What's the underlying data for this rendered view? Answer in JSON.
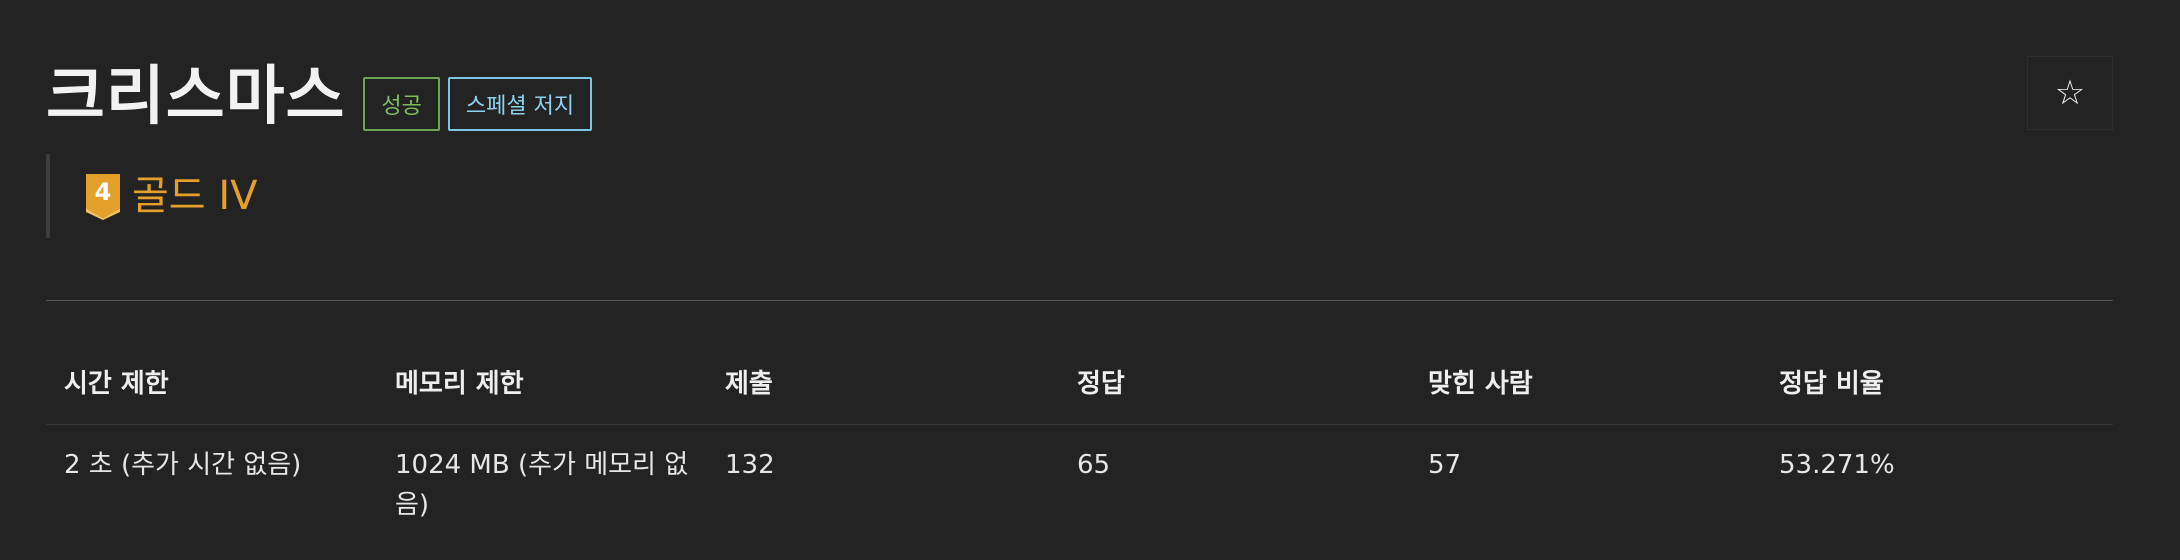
{
  "problem": {
    "title": "크리스마스",
    "badges": {
      "success": "성공",
      "special_judge": "스페셜 저지"
    },
    "tier": {
      "label": "골드 IV",
      "level_number": "4",
      "color": "#e4a02a"
    }
  },
  "actions": {
    "favorite_icon": "star-icon"
  },
  "stats": {
    "headers": [
      "시간 제한",
      "메모리 제한",
      "제출",
      "정답",
      "맞힌 사람",
      "정답 비율"
    ],
    "values": [
      "2 초 (추가 시간 없음)",
      "1024 MB (추가 메모리 없음)",
      "132",
      "65",
      "57",
      "53.271%"
    ]
  },
  "colors": {
    "background": "#232323",
    "success": "#7fbf5f",
    "special_judge": "#8fd3f0",
    "gold": "#e4a02a"
  }
}
